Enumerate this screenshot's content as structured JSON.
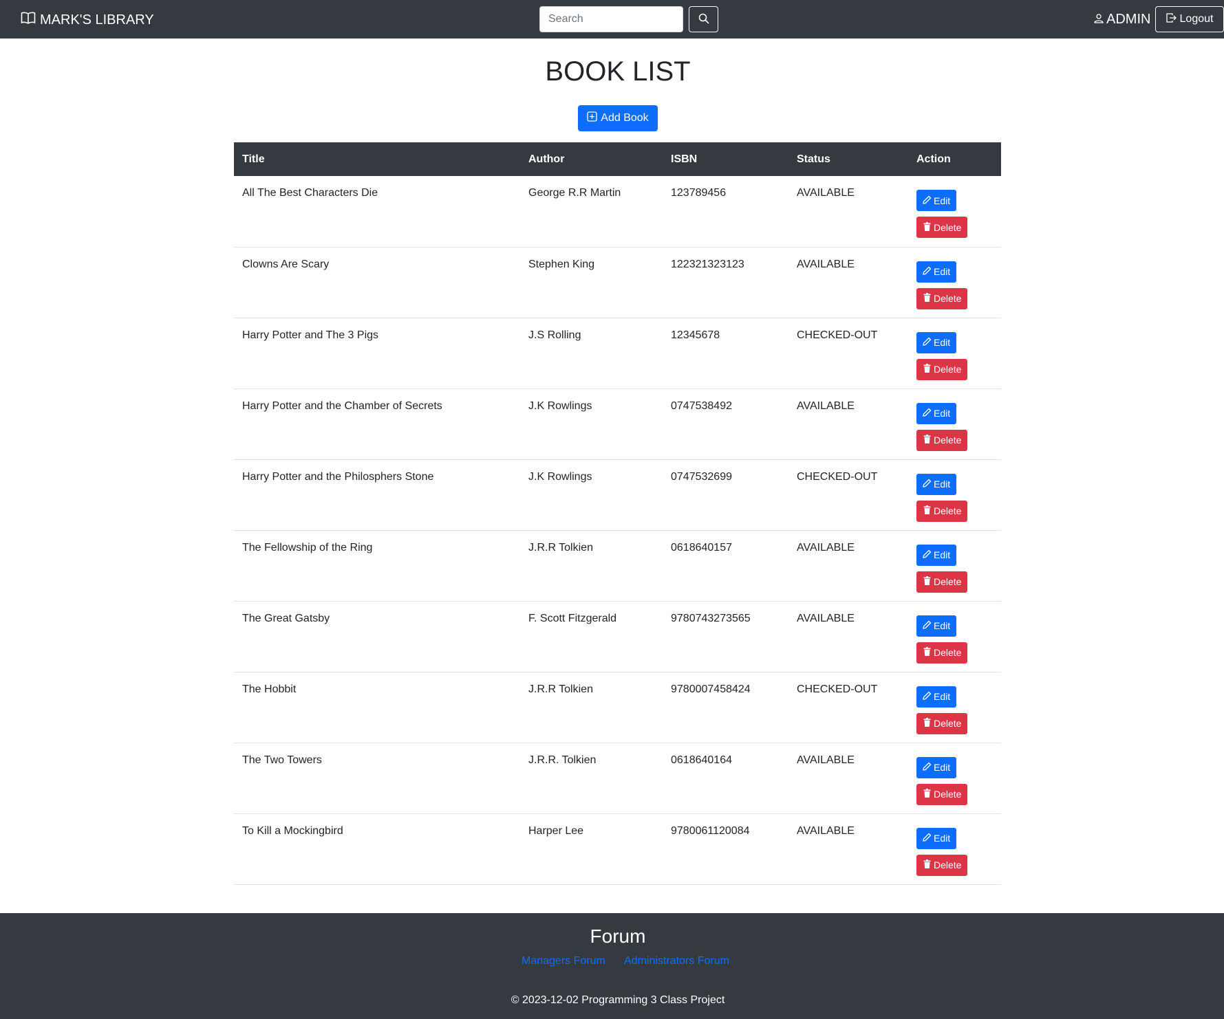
{
  "nav": {
    "brand": "MARK'S LIBRARY",
    "search_placeholder": "Search",
    "user": "ADMIN",
    "logout": "Logout"
  },
  "page": {
    "title": "BOOK LIST",
    "add_button": "Add Book"
  },
  "table": {
    "headers": [
      "Title",
      "Author",
      "ISBN",
      "Status",
      "Action"
    ],
    "edit_label": "Edit",
    "delete_label": "Delete",
    "rows": [
      {
        "title": "All The Best Characters Die",
        "author": "George R.R Martin",
        "isbn": "123789456",
        "status": "AVAILABLE"
      },
      {
        "title": "Clowns Are Scary",
        "author": "Stephen King",
        "isbn": "122321323123",
        "status": "AVAILABLE"
      },
      {
        "title": "Harry Potter and The 3 Pigs",
        "author": "J.S Rolling",
        "isbn": "12345678",
        "status": "CHECKED-OUT"
      },
      {
        "title": "Harry Potter and the Chamber of Secrets",
        "author": "J.K Rowlings",
        "isbn": "0747538492",
        "status": "AVAILABLE"
      },
      {
        "title": "Harry Potter and the Philosphers Stone",
        "author": "J.K Rowlings",
        "isbn": "0747532699",
        "status": "CHECKED-OUT"
      },
      {
        "title": "The Fellowship of the Ring",
        "author": "J.R.R Tolkien",
        "isbn": "0618640157",
        "status": "AVAILABLE"
      },
      {
        "title": "The Great Gatsby",
        "author": "F. Scott Fitzgerald",
        "isbn": "9780743273565",
        "status": "AVAILABLE"
      },
      {
        "title": "The Hobbit",
        "author": "J.R.R Tolkien",
        "isbn": "9780007458424",
        "status": "CHECKED-OUT"
      },
      {
        "title": "The Two Towers",
        "author": "J.R.R. Tolkien",
        "isbn": "0618640164",
        "status": "AVAILABLE"
      },
      {
        "title": "To Kill a Mockingbird",
        "author": "Harper Lee",
        "isbn": "9780061120084",
        "status": "AVAILABLE"
      }
    ]
  },
  "footer": {
    "title": "Forum",
    "links": [
      "Managers Forum",
      "Administrators Forum"
    ],
    "copyright": "© 2023-12-02 Programming 3 Class Project"
  },
  "colors": {
    "navbar_bg": "#343a40",
    "primary": "#0d6efd",
    "danger": "#dc3545"
  }
}
